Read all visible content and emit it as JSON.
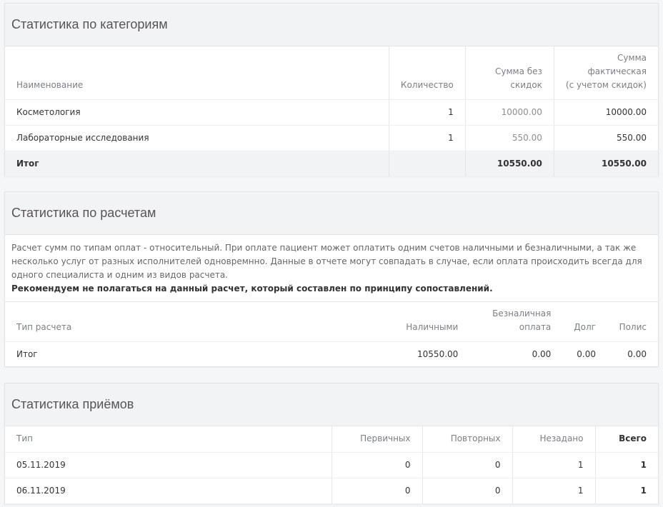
{
  "categories": {
    "title": "Статистика по категориям",
    "headers": {
      "name": "Наименование",
      "quantity": "Количество",
      "sum_no_discount_1": "Сумма без",
      "sum_no_discount_2": "скидок",
      "sum_actual_1": "Сумма",
      "sum_actual_2": "фактическая",
      "sum_actual_3": "(с учетом скидок)"
    },
    "rows": [
      {
        "name": "Косметология",
        "quantity": "1",
        "sum_no_discount": "10000.00",
        "sum_actual": "10000.00"
      },
      {
        "name": "Лабораторные исследования",
        "quantity": "1",
        "sum_no_discount": "550.00",
        "sum_actual": "550.00"
      }
    ],
    "total": {
      "name": "Итог",
      "sum_no_discount": "10550.00",
      "sum_actual": "10550.00"
    }
  },
  "payments": {
    "title": "Статистика по расчетам",
    "note": "Расчет сумм по типам оплат - относительный. При оплате пациент может оплатить одним счетов наличными и безналичными, а так же несколько услуг от разных исполнителей одновремнно. Данные в отчете могут совпадать в случае, если оплата происходить всегда для одного специалиста и одним из видов расчета.",
    "warning": "Рекомендуем не полагаться на данный расчет, который составлен по принципу сопоставлений.",
    "headers": {
      "type": "Тип расчета",
      "cash": "Наличными",
      "cashless_1": "Безналичная",
      "cashless_2": "оплата",
      "debt": "Долг",
      "policy": "Полис"
    },
    "total": {
      "type": "Итог",
      "cash": "10550.00",
      "cashless": "0.00",
      "debt": "0.00",
      "policy": "0.00"
    }
  },
  "visits": {
    "title": "Статистика приёмов",
    "headers": {
      "type": "Тип",
      "primary": "Первичных",
      "repeat": "Повторных",
      "unset": "Незадано",
      "total": "Всего"
    },
    "rows": [
      {
        "type": "05.11.2019",
        "primary": "0",
        "repeat": "0",
        "unset": "1",
        "total": "1"
      },
      {
        "type": "06.11.2019",
        "primary": "0",
        "repeat": "0",
        "unset": "1",
        "total": "1"
      }
    ]
  }
}
